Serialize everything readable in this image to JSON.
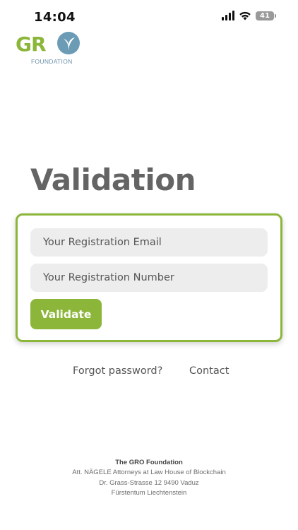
{
  "status_bar": {
    "time": "14:04",
    "battery_level": "41",
    "icons": [
      "signal-icon",
      "wifi-icon",
      "battery-icon"
    ]
  },
  "logo": {
    "text": "GR",
    "subtitle": "FOUNDATION",
    "color": "#8bb63a",
    "leaf_color": "#6b9bb5"
  },
  "page": {
    "title": "Validation"
  },
  "form": {
    "email_placeholder": "Your Registration Email",
    "number_placeholder": "Your Registration Number",
    "validate_label": "Validate",
    "accent_color": "#8bb63a"
  },
  "links": {
    "forgot_password": "Forgot password?",
    "contact": "Contact"
  },
  "footer": {
    "title": "The GRO Foundation",
    "lines": [
      "Att. NÄGELE Attorneys at Law House of Blockchain",
      "Dr. Grass-Strasse 12 9490 Vaduz",
      "Fürstentum Liechtenstein"
    ]
  }
}
